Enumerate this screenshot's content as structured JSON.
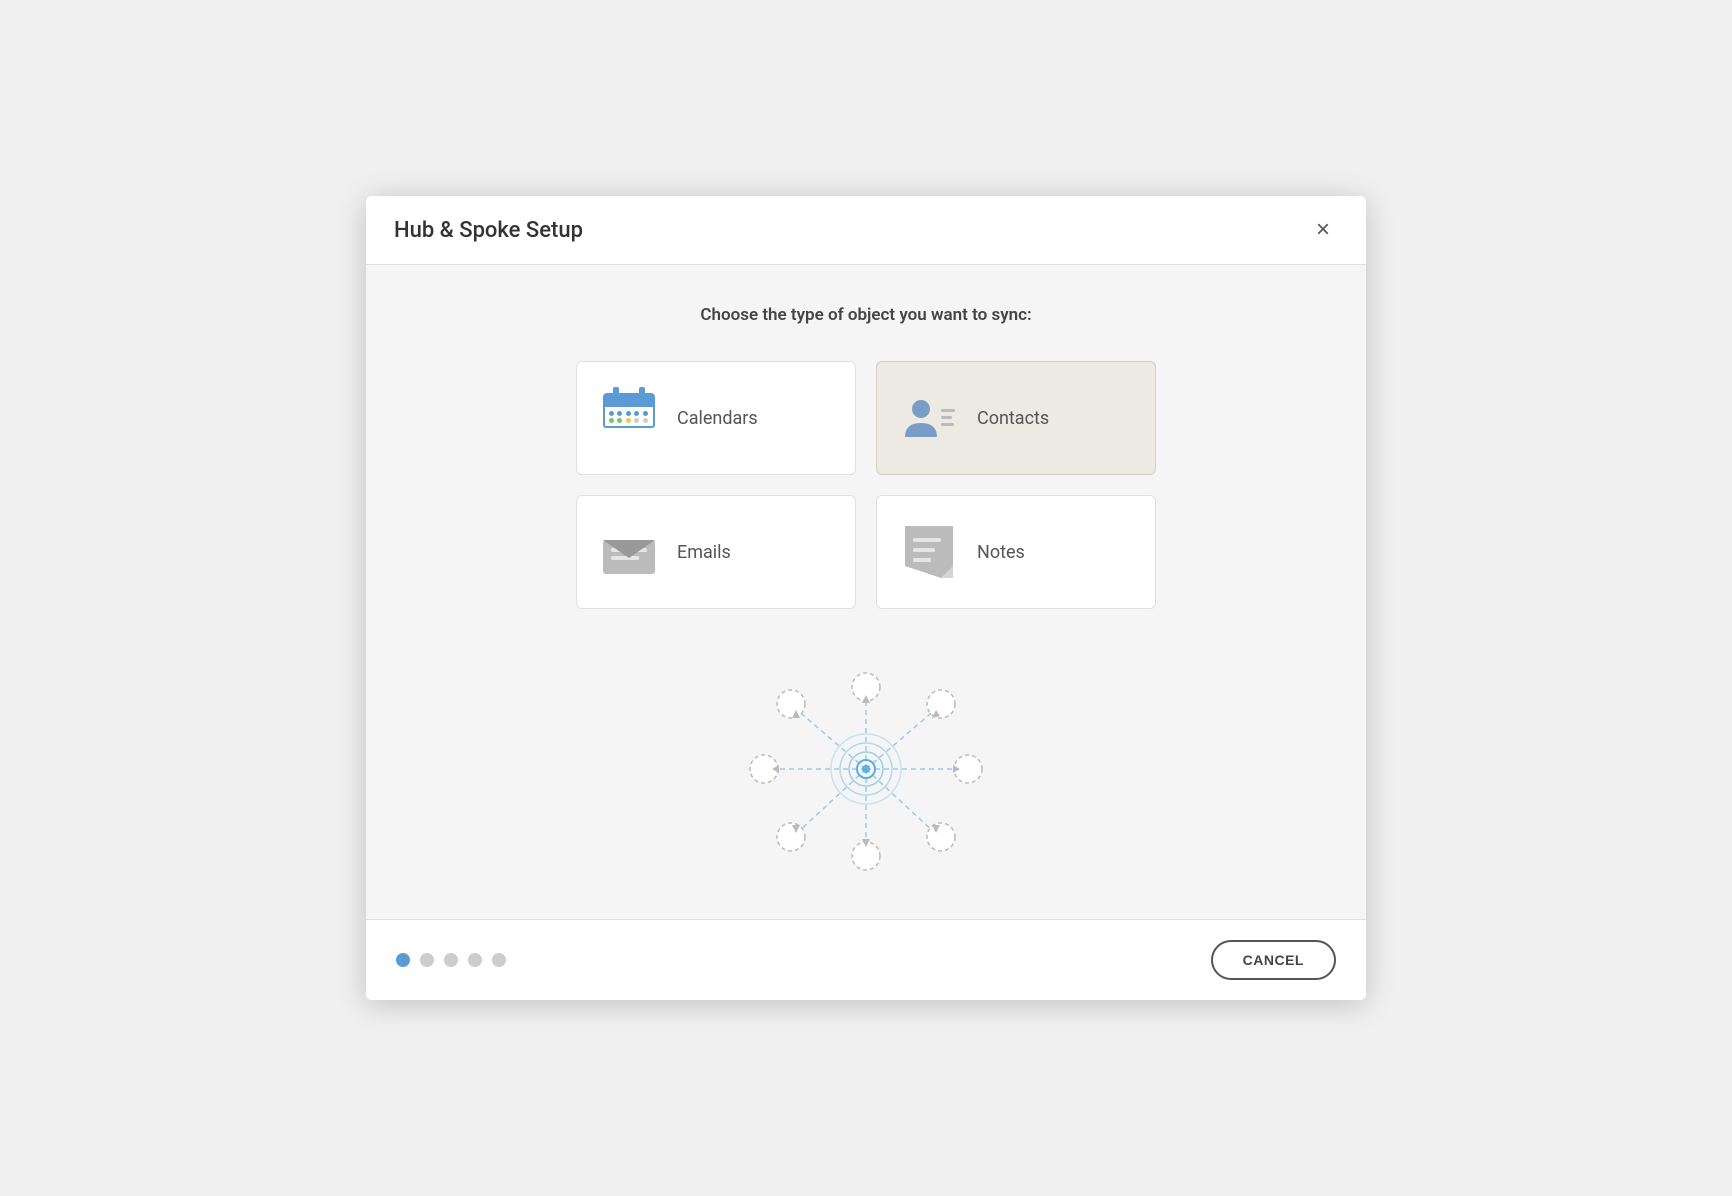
{
  "dialog": {
    "title": "Hub & Spoke Setup",
    "close_label": "×"
  },
  "instruction": "Choose the type of object you want to sync:",
  "cards": [
    {
      "id": "calendars",
      "label": "Calendars",
      "icon": "calendar-icon",
      "selected": false
    },
    {
      "id": "contacts",
      "label": "Contacts",
      "icon": "contact-icon",
      "selected": true
    },
    {
      "id": "emails",
      "label": "Emails",
      "icon": "email-icon",
      "selected": false
    },
    {
      "id": "notes",
      "label": "Notes",
      "icon": "notes-icon",
      "selected": false
    }
  ],
  "footer": {
    "steps": [
      {
        "id": "step1",
        "active": true
      },
      {
        "id": "step2",
        "active": false
      },
      {
        "id": "step3",
        "active": false
      },
      {
        "id": "step4",
        "active": false
      },
      {
        "id": "step5",
        "active": false
      }
    ],
    "cancel_label": "CANCEL"
  }
}
